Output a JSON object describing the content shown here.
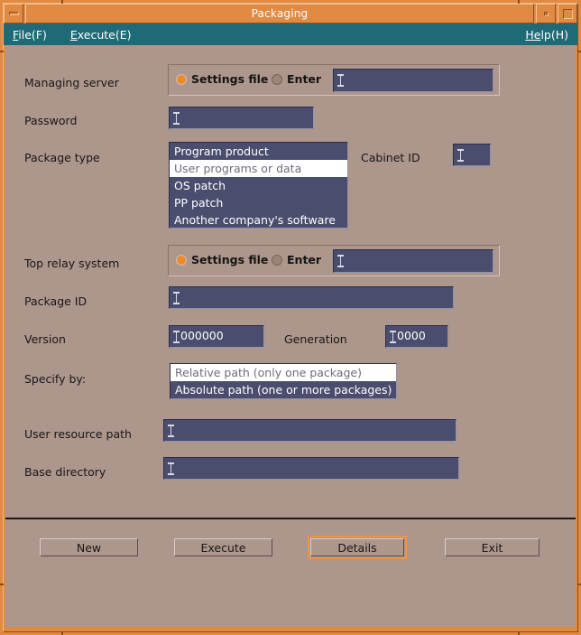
{
  "window": {
    "title": "Packaging",
    "menu_button_icon": "window-menu-icon",
    "minimize_icon": "minimize-icon",
    "maximize_icon": "maximize-icon"
  },
  "menubar": {
    "items": [
      {
        "mnemonic": "F",
        "rest": "ile(F)"
      },
      {
        "mnemonic": "E",
        "rest": "xecute(E)"
      }
    ],
    "help": {
      "mnemonic": "He",
      "rest": "lp(H)"
    }
  },
  "form": {
    "managing_server": {
      "label": "Managing server",
      "radio_settings_file": "Settings file",
      "radio_enter": "Enter",
      "selected": "Settings file",
      "value": ""
    },
    "password": {
      "label": "Password",
      "value": ""
    },
    "package_type": {
      "label": "Package type",
      "options": [
        "Program product",
        "User programs or data",
        "OS patch",
        "PP patch",
        "Another company's software"
      ],
      "selected_index": 1
    },
    "cabinet_id": {
      "label": "Cabinet ID",
      "value": ""
    },
    "top_relay_system": {
      "label": "Top relay system",
      "radio_settings_file": "Settings file",
      "radio_enter": "Enter",
      "selected": "Settings file",
      "value": ""
    },
    "package_id": {
      "label": "Package ID",
      "value": ""
    },
    "version": {
      "label": "Version",
      "value": "000000"
    },
    "generation": {
      "label": "Generation",
      "value": "0000"
    },
    "specify_by": {
      "label": "Specify by:",
      "options": [
        "Relative path (only one package)",
        "Absolute path (one or more packages)"
      ],
      "selected_index": 0
    },
    "user_resource_path": {
      "label": "User resource path",
      "value": ""
    },
    "base_directory": {
      "label": "Base directory",
      "value": ""
    }
  },
  "buttons": {
    "new": "New",
    "execute": "Execute",
    "details": "Details",
    "exit": "Exit",
    "focused": "Details"
  },
  "colors": {
    "titlebar": "#e08a42",
    "menubar": "#1e6b77",
    "client": "#ad968c",
    "field": "#4b4d6e",
    "accent": "#f08a28"
  }
}
